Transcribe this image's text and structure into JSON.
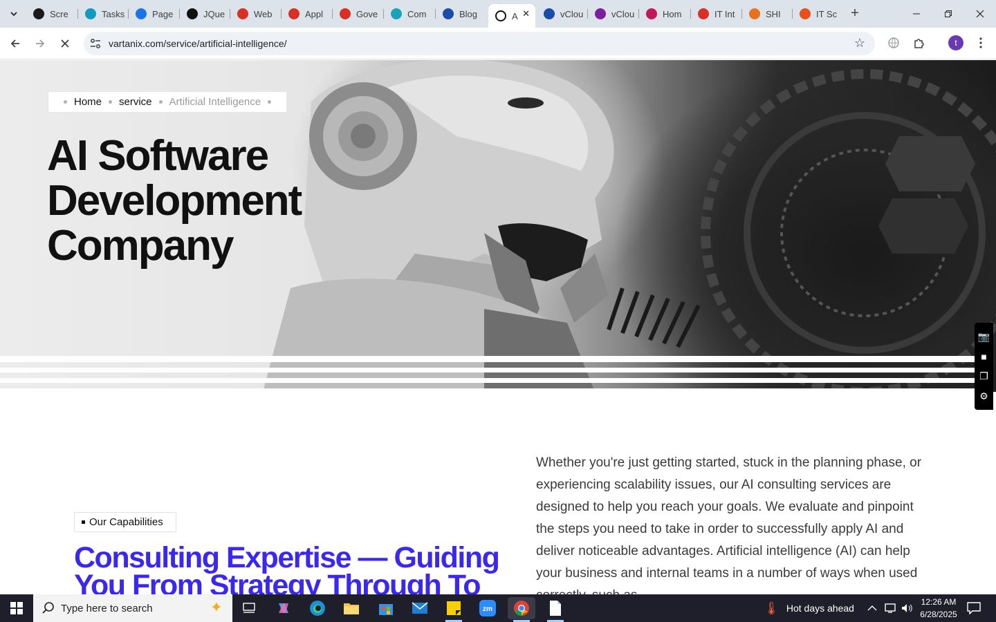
{
  "browser": {
    "tabs": [
      {
        "label": "Scre",
        "color": "#1a1a1a"
      },
      {
        "label": "Tasks",
        "color": "#0f9bbd"
      },
      {
        "label": "Page",
        "color": "#1a73e8"
      },
      {
        "label": "JQue",
        "color": "#111111"
      },
      {
        "label": "Web",
        "color": "#d93025"
      },
      {
        "label": "Appl",
        "color": "#d93025"
      },
      {
        "label": "Gove",
        "color": "#d93025"
      },
      {
        "label": "Com",
        "color": "#1aa3b8"
      },
      {
        "label": "Blog",
        "color": "#1a4da8"
      },
      {
        "label": "A",
        "color": "#111111"
      },
      {
        "label": "vClou",
        "color": "#1a4da8"
      },
      {
        "label": "vClou",
        "color": "#7a1fa2"
      },
      {
        "label": "Hom",
        "color": "#c2185b"
      },
      {
        "label": "IT Int",
        "color": "#d93025"
      },
      {
        "label": "SHI",
        "color": "#e8711a"
      },
      {
        "label": "IT Sc",
        "color": "#e8501a"
      }
    ],
    "url": "vartanix.com/service/artificial-intelligence/"
  },
  "page": {
    "breadcrumb": {
      "home": "Home",
      "service": "service",
      "current": "Artificial Intelligence"
    },
    "hero_title_lines": [
      "AI Software",
      "Development",
      "Company"
    ],
    "capabilities_label": "Our Capabilities",
    "blue_heading": "Consulting Expertise — Guiding You From Strategy Through To",
    "body_text": "Whether you're just getting started, stuck in the planning phase, or experiencing scalability issues, our AI consulting services are designed to help you reach your goals. We evaluate and pinpoint the steps you need to take in order to successfully apply AI and deliver noticeable advantages. Artificial intelligence (AI) can help your business and internal teams in a number of ways when used correctly, such as"
  },
  "taskbar": {
    "search_placeholder": "Type here to search",
    "weather": "Hot days ahead",
    "time": "12:26 AM",
    "date": "6/28/2025"
  },
  "colors": {
    "accent_blue": "#3b28f0",
    "taskbar_bg": "#1f1f2b",
    "profile": "#6a3ab2"
  }
}
